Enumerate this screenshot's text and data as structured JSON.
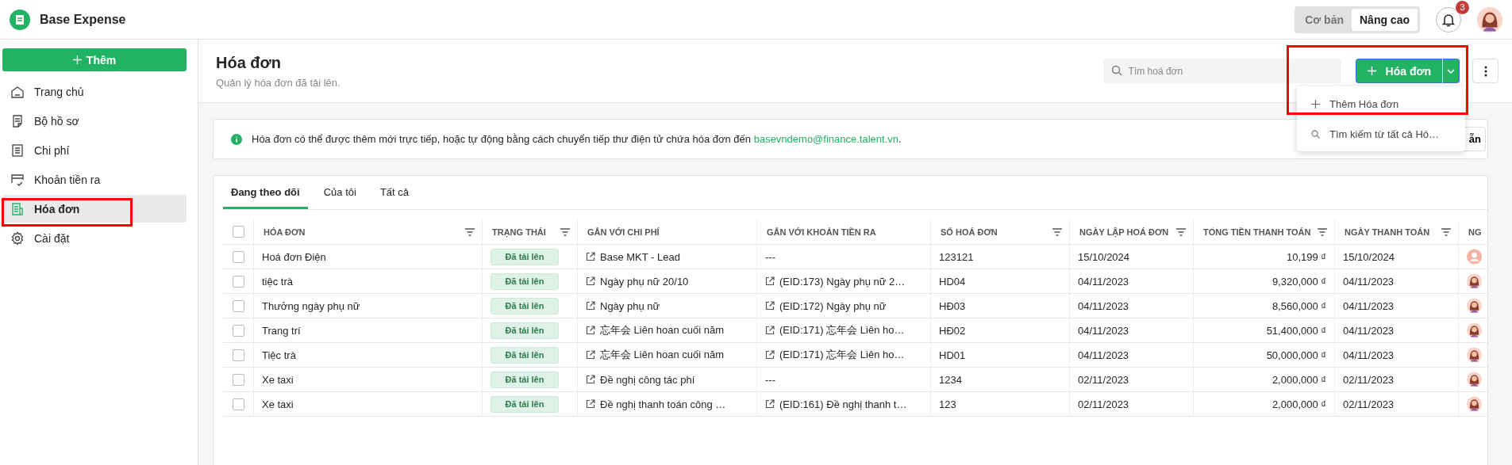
{
  "app": {
    "name": "Base Expense"
  },
  "mode_toggle": [
    {
      "label": "Cơ bản",
      "selected": false
    },
    {
      "label": "Nâng cao",
      "selected": true
    }
  ],
  "notifications": {
    "count": "3"
  },
  "sidebar": {
    "add_button": "Thêm",
    "items": [
      {
        "label": "Trang chủ",
        "kind": "home",
        "selected": false
      },
      {
        "label": "Bộ hồ sơ",
        "kind": "file",
        "selected": false
      },
      {
        "label": "Chi phí",
        "kind": "list",
        "selected": false
      },
      {
        "label": "Khoản tiền ra",
        "kind": "card",
        "selected": false
      },
      {
        "label": "Hóa đơn",
        "kind": "invoice",
        "selected": true
      },
      {
        "label": "Cài đặt",
        "kind": "gear",
        "selected": false
      }
    ]
  },
  "page": {
    "title": "Hóa đơn",
    "subtitle": "Quản lý hóa đơn đã tải lên.",
    "search": {
      "placeholder": "Tìm hoá đơn"
    },
    "add_button": "Hóa đơn"
  },
  "dropdown_menu": [
    {
      "label": "Thêm Hóa đơn",
      "kind": "add"
    },
    {
      "label": "Tìm kiếm từ tất cả Hó…",
      "kind": "search"
    }
  ],
  "info": {
    "text": "Hóa đơn có thể được thêm mới trực tiếp, hoặc tự động bằng cách chuyển tiếp thư điện tử chứa hóa đơn đến ",
    "email": "basevndemo@finance.talent.vn",
    "tail": ".",
    "button": "ẫn"
  },
  "tabs": [
    {
      "label": "Đang theo dõi",
      "selected": true
    },
    {
      "label": "Của tôi",
      "selected": false
    },
    {
      "label": "Tất cả",
      "selected": false
    }
  ],
  "table": {
    "header_checked": false,
    "columns": [
      {
        "label": "HÓA ĐƠN",
        "filter": true
      },
      {
        "label": "TRẠNG THÁI",
        "filter": true
      },
      {
        "label": "GẮN VỚI CHI PHÍ",
        "filter": false
      },
      {
        "label": "GẮN VỚI KHOẢN TIỀN RA",
        "filter": false
      },
      {
        "label": "SỐ HOÁ ĐƠN",
        "filter": true
      },
      {
        "label": "NGÀY LẬP HOÁ ĐƠN",
        "filter": true
      },
      {
        "label": "TỔNG TIỀN THANH TOÁN",
        "filter": true
      },
      {
        "label": "NGÀY THANH TOÁN",
        "filter": true
      },
      {
        "label": "NG",
        "filter": false
      }
    ],
    "rows": [
      {
        "checked": false,
        "name": "Hoá đơn Điện",
        "status": "Đã tải lên",
        "expense": "Base MKT - Lead",
        "payout": "---",
        "number": "123121",
        "date": "15/10/2024",
        "total": "10,199 ₫",
        "paid_date": "15/10/2024",
        "kind": "placeholder"
      },
      {
        "checked": false,
        "name": "tiệc trà",
        "status": "Đã tải lên",
        "expense": "Ngày phụ nữ 20/10",
        "payout": "(EID:173) Ngày phụ nữ 2…",
        "number": "HD04",
        "date": "04/11/2023",
        "total": "9,320,000 ₫",
        "paid_date": "04/11/2023",
        "kind": "person"
      },
      {
        "checked": false,
        "name": "Thưởng ngày phụ nữ",
        "status": "Đã tải lên",
        "expense": "Ngày phụ nữ",
        "payout": "(EID:172) Ngày phụ nữ",
        "number": "HĐ03",
        "date": "04/11/2023",
        "total": "8,560,000 ₫",
        "paid_date": "04/11/2023",
        "kind": "person"
      },
      {
        "checked": false,
        "name": "Trang trí",
        "status": "Đã tải lên",
        "expense": "忘年会 Liên hoan cuối năm",
        "payout": "(EID:171) 忘年会 Liên ho…",
        "number": "HĐ02",
        "date": "04/11/2023",
        "total": "51,400,000 ₫",
        "paid_date": "04/11/2023",
        "kind": "person"
      },
      {
        "checked": false,
        "name": "Tiệc trà",
        "status": "Đã tải lên",
        "expense": "忘年会 Liên hoan cuối năm",
        "payout": "(EID:171) 忘年会 Liên ho…",
        "number": "HD01",
        "date": "04/11/2023",
        "total": "50,000,000 ₫",
        "paid_date": "04/11/2023",
        "kind": "person"
      },
      {
        "checked": false,
        "name": "Xe taxi",
        "status": "Đã tải lên",
        "expense": "Đề nghị công tác phí",
        "payout": "---",
        "number": "1234",
        "date": "02/11/2023",
        "total": "2,000,000 ₫",
        "paid_date": "02/11/2023",
        "kind": "person"
      },
      {
        "checked": false,
        "name": "Xe taxi",
        "status": "Đã tải lên",
        "expense": "Đề nghị thanh toán công …",
        "payout": "(EID:161) Đề nghị thanh t…",
        "number": "123",
        "date": "02/11/2023",
        "total": "2,000,000 ₫",
        "paid_date": "02/11/2023",
        "kind": "person"
      }
    ]
  }
}
